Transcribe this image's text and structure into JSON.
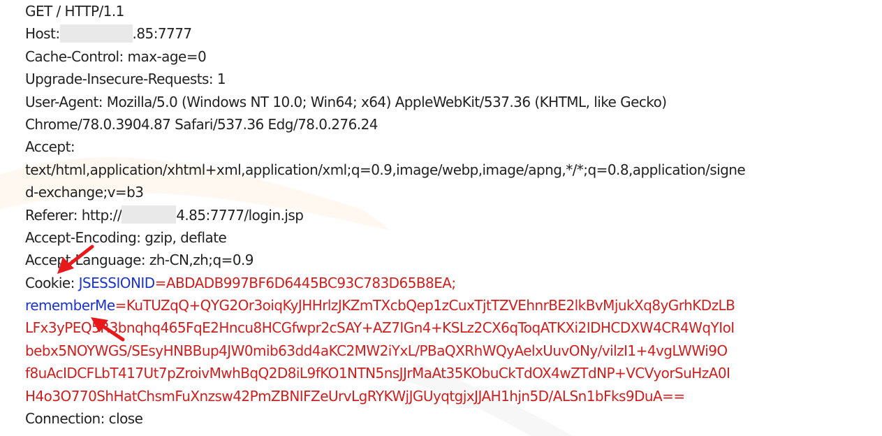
{
  "request": {
    "request_line": "GET / HTTP/1.1",
    "host": {
      "key": "Host:",
      "value_suffix": ".85:7777"
    },
    "cache_control": "Cache-Control: max-age=0",
    "upgrade_insecure": "Upgrade-Insecure-Requests: 1",
    "user_agent": {
      "line1": "User-Agent: Mozilla/5.0 (Windows NT 10.0; Win64; x64) AppleWebKit/537.36 (KHTML, like Gecko)",
      "line2": "Chrome/78.0.3904.87 Safari/537.36 Edg/78.0.276.24"
    },
    "accept": {
      "key": "Accept:",
      "line1": "text/html,application/xhtml+xml,application/xml;q=0.9,image/webp,image/apng,*/*;q=0.8,application/signe",
      "line2": "d-exchange;v=b3"
    },
    "referer": {
      "key": "Referer: http://",
      "value_suffix": "4.85:7777/login.jsp"
    },
    "accept_encoding": "Accept-Encoding: gzip, deflate",
    "accept_language": "Accept-Language: zh-CN,zh;q=0.9",
    "cookie": {
      "key": "Cookie: ",
      "jsession_name": "JSESSIONID",
      "jsession_value": "=ABDADB997BF6D6445BC93C783D65B8EA;",
      "remember_name": "rememberMe",
      "remember_value_line1": "=KuTUZqQ+QYG2Or3oiqKyJHHrlzJKZmTXcbQep1zCuxTjtTZVEhnrBE2lkBvMjukXq8yGrhKDzLB",
      "remember_value_line2": "LFx3yPEQ5R3bnqhq465FqE2Hncu8HCGfwpr2cSAY+AZ7IGn4+KSLz2CX6qToqATKXi2IDHCDXW4CR4WqYIoI",
      "remember_value_line3": "bebx5NOYWGS/SEsyHNBBup4JW0mib63dd4aKC2MW2iYxL/PBaQXRhWQyAelxUuvONy/vilzI1+4vgLWWi9O",
      "remember_value_line4": "f8uAcIDCFLbT417Ut7pZroivMwhBqQ2D8iL9fKO1NTN5nsJJrMaAt35KObuCkTdOX4wZTdNP+VCVyorSuHzA0I",
      "remember_value_line5": "H4o3O770ShHatChsmFuXnzsw42PmZBNIFZeUrvLgRYKWjJGUyqtgjxJJAH1hjn5D/ALSn1bFks9DuA=="
    },
    "connection": "Connection: close"
  },
  "colors": {
    "text": "#222222",
    "cookie_name": "#1a33cc",
    "cookie_value": "#cc1f1f",
    "arrow": "#e8191a",
    "redaction": "#e9e9e9"
  },
  "icons": [
    "red-arrow-icon",
    "red-arrow-icon"
  ]
}
